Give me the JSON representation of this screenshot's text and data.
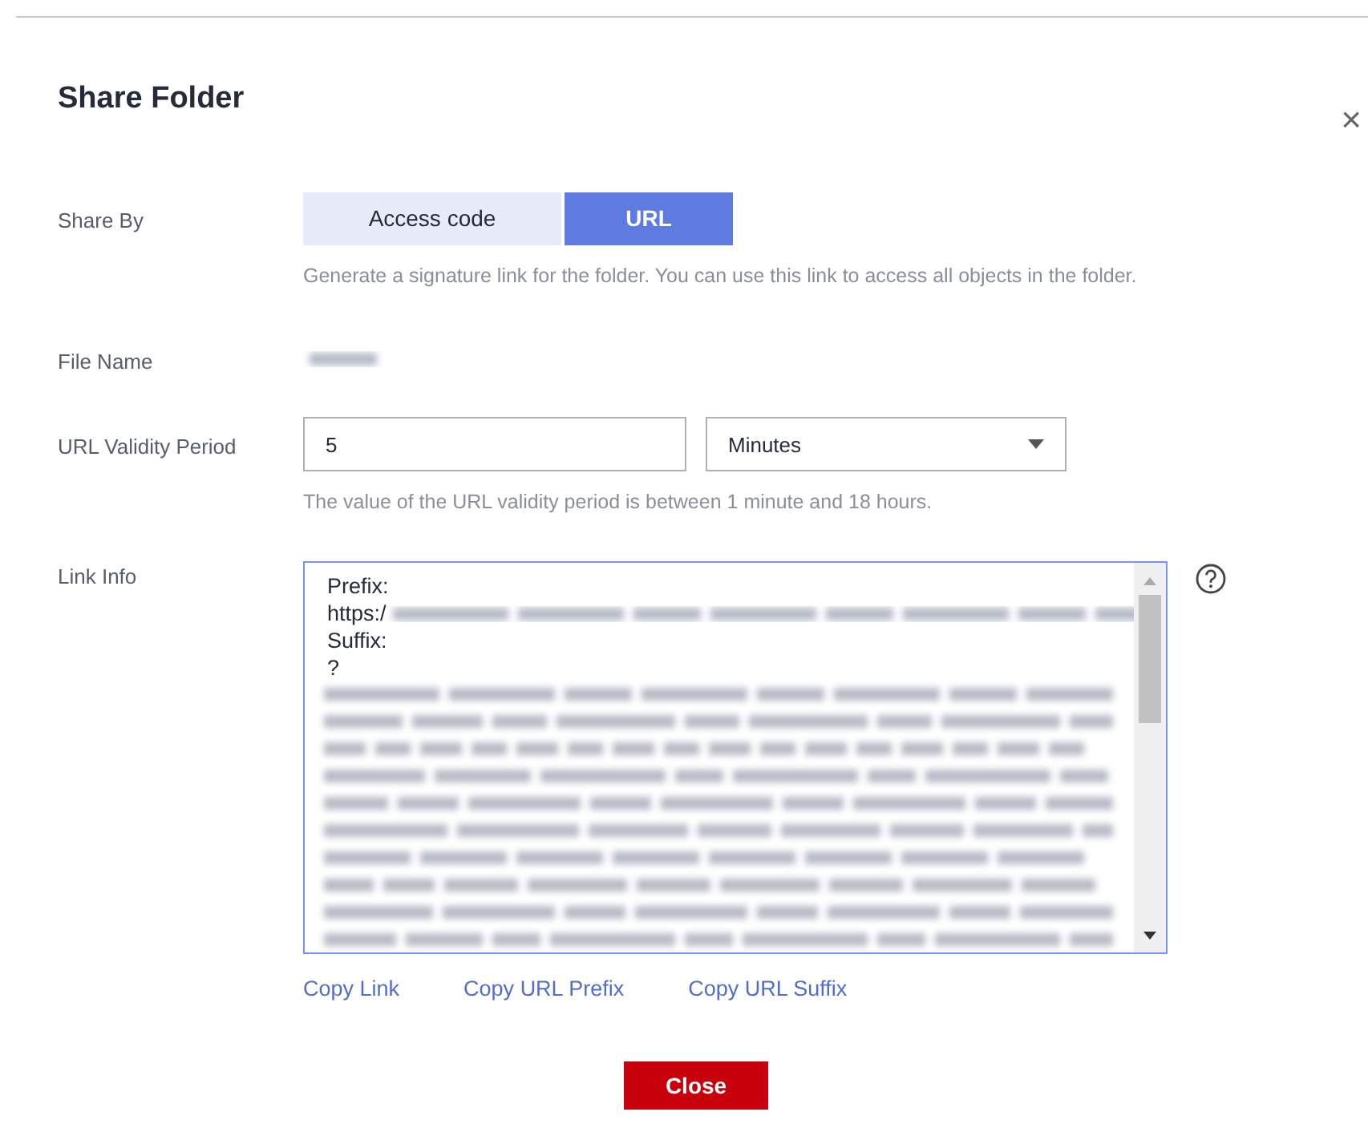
{
  "dialog": {
    "title": "Share Folder",
    "close_glyph": "×"
  },
  "share_by": {
    "label": "Share By",
    "options": [
      {
        "label": "Access code",
        "selected": false
      },
      {
        "label": "URL",
        "selected": true
      }
    ],
    "hint": "Generate a signature link for the folder. You can use this link to access all objects in the folder."
  },
  "file_name": {
    "label": "File Name"
  },
  "validity": {
    "label": "URL Validity Period",
    "value": "5",
    "unit": "Minutes",
    "hint": "The value of the URL validity period is between 1 minute and 18 hours."
  },
  "link_info": {
    "label": "Link Info",
    "lines": [
      "Prefix:",
      "https:/",
      "Suffix:",
      "?"
    ],
    "links": [
      "Copy Link",
      "Copy URL Prefix",
      "Copy URL Suffix"
    ]
  },
  "footer": {
    "close_button": "Close"
  }
}
